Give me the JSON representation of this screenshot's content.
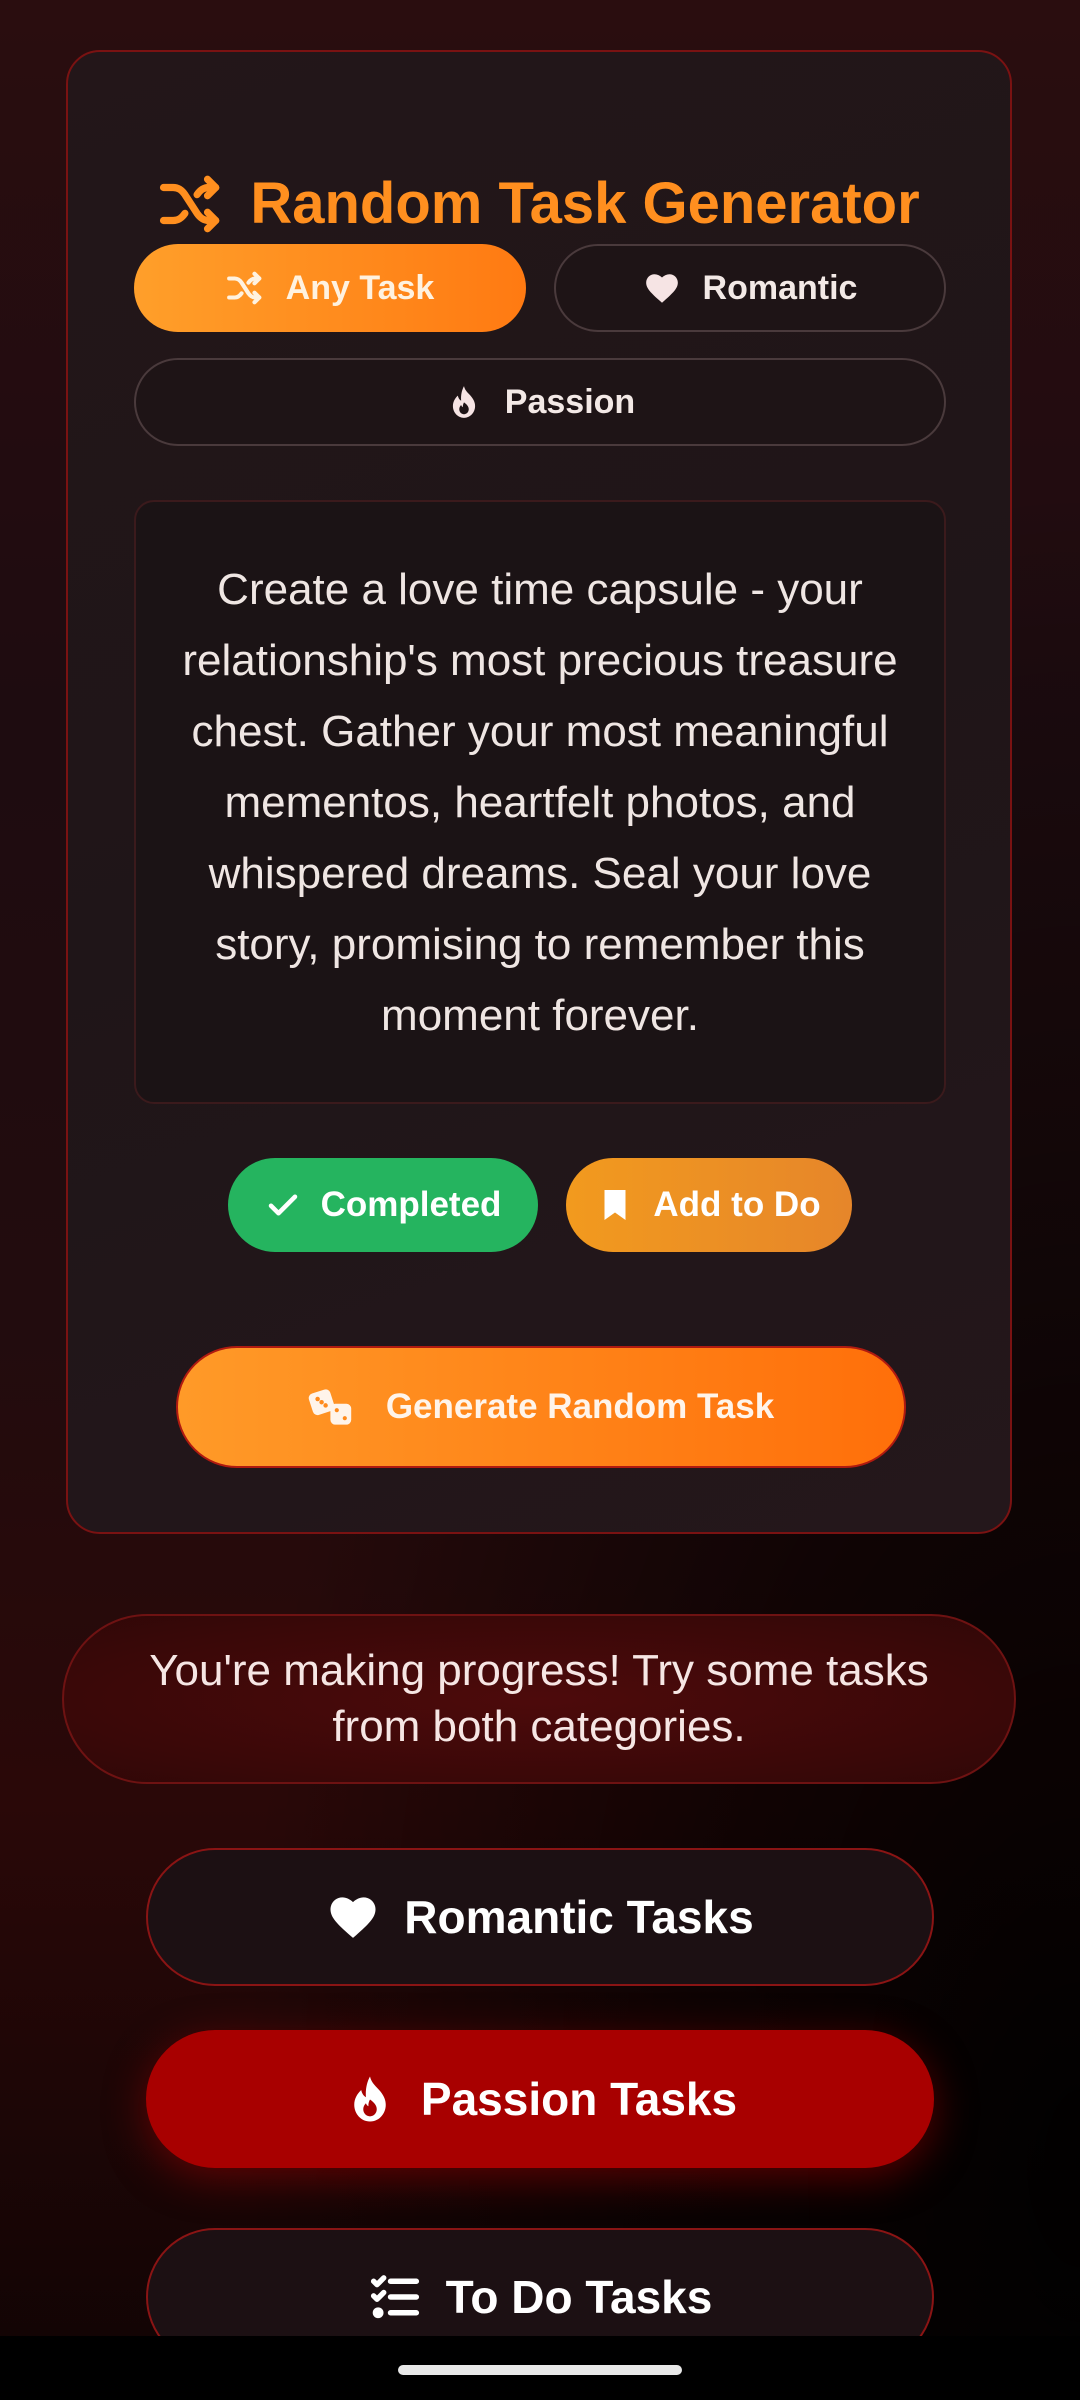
{
  "colors": {
    "accent": "#ff8f1f",
    "completed": "#25b45f",
    "passion": "#a80000",
    "border": "#7a1212"
  },
  "header": {
    "title": "Random Task Generator",
    "icon": "shuffle-icon"
  },
  "filters": [
    {
      "label": "Any Task",
      "icon": "shuffle-icon",
      "selected": true
    },
    {
      "label": "Romantic",
      "icon": "heart-icon",
      "selected": false
    },
    {
      "label": "Passion",
      "icon": "fire-icon",
      "selected": false
    }
  ],
  "task": {
    "text": "Create a love time capsule - your relationship's most precious treasure chest. Gather your most meaningful mementos, heartfelt photos, and whispered dreams. Seal your love story, promising to remember this moment forever."
  },
  "actions": {
    "completed_label": "Completed",
    "completed_icon": "check-icon",
    "todo_label": "Add to Do",
    "todo_icon": "bookmark-icon"
  },
  "generate": {
    "label": "Generate Random Task",
    "icon": "dice-icon"
  },
  "progress": {
    "message": "You're making progress! Try some tasks from both categories."
  },
  "nav": [
    {
      "label": "Romantic Tasks",
      "icon": "heart-icon"
    },
    {
      "label": "Passion Tasks",
      "icon": "fire-icon"
    },
    {
      "label": "To Do Tasks",
      "icon": "checklist-icon"
    }
  ]
}
